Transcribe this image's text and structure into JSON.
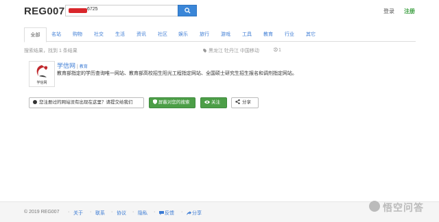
{
  "header": {
    "logo": "REG007",
    "search_value": "6725",
    "login": "登录",
    "register": "注册"
  },
  "tabs": [
    "全部",
    "名站",
    "购物",
    "社交",
    "生活",
    "资讯",
    "社区",
    "娱乐",
    "旅行",
    "游戏",
    "工具",
    "教育",
    "行业",
    "其它"
  ],
  "meta": {
    "summary": "搜索结果，找到 1 条结果",
    "location": "黑龙江 牡丹江 中国移动",
    "history": "1"
  },
  "result": {
    "thumb_label": "学信网",
    "name": "学信网",
    "category": "教育",
    "description": "教育部指定的学历查询唯一网站、教育部高校招生阳光工程指定网站、全国硕士研究生招生报名和调剂指定网站。"
  },
  "actions": {
    "report": "您注册过的网站没有出现在这里？请提交给我们",
    "block": "屏蔽对您的搜索",
    "follow": "关注",
    "share": "分享"
  },
  "footer": {
    "copyright": "© 2019 REG007",
    "about": "关于",
    "contact": "联系",
    "terms": "协议",
    "privacy": "隐私",
    "feedback": "反馈",
    "share": "分享"
  },
  "watermark": "悟空问答",
  "colors": {
    "accent": "#3a86d8",
    "green": "#4c9e47",
    "brand_red": "#d9262b"
  }
}
